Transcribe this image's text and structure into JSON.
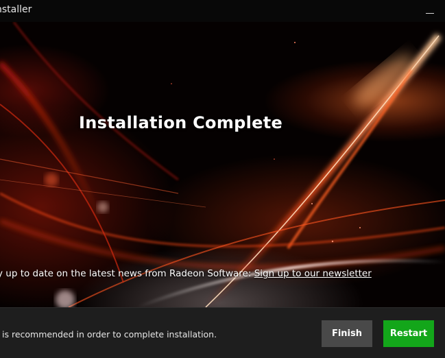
{
  "window": {
    "title": "nstaller"
  },
  "hero": {
    "headline": "Installation Complete",
    "news_text": "y up to date on the latest news from Radeon Software: ",
    "news_link": "Sign up to our newsletter"
  },
  "footer": {
    "message": " is recommended in order to complete installation.",
    "finish_label": "Finish",
    "restart_label": "Restart"
  },
  "colors": {
    "finish_button": "#494949",
    "restart_button": "#13a61a",
    "footer_bg": "#1e1e1e",
    "accent_red": "#e0300f"
  },
  "icons": {
    "minimize": "minimize-icon"
  }
}
